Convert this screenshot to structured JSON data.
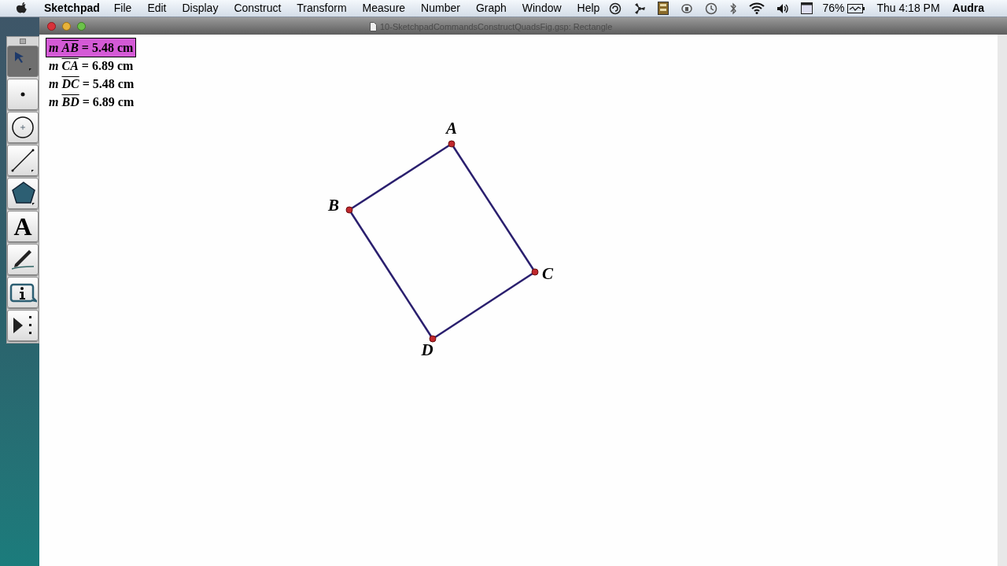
{
  "menu_bar": {
    "app": "Sketchpad",
    "menus": [
      "File",
      "Edit",
      "Display",
      "Construct",
      "Transform",
      "Measure",
      "Number",
      "Graph",
      "Window",
      "Help"
    ],
    "battery": "76%",
    "clock": "Thu 4:18 PM",
    "user": "Audra"
  },
  "window": {
    "title": "10-SketchpadCommandsConstructQuadsFig.gsp: Rectangle"
  },
  "toolbox": [
    {
      "kind": "arrow",
      "selected": true
    },
    {
      "kind": "point",
      "selected": false
    },
    {
      "kind": "compass",
      "selected": false
    },
    {
      "kind": "straightedge",
      "selected": false
    },
    {
      "kind": "polygon",
      "selected": false
    },
    {
      "kind": "text",
      "selected": false,
      "glyph": "A"
    },
    {
      "kind": "marker",
      "selected": false
    },
    {
      "kind": "information",
      "selected": false
    },
    {
      "kind": "custom",
      "selected": false
    }
  ],
  "measurements": [
    {
      "prefix": "m",
      "segment": "AB",
      "result": "= 5.48 cm",
      "selected": true
    },
    {
      "prefix": "m",
      "segment": "CA",
      "result": "= 6.89 cm",
      "selected": false
    },
    {
      "prefix": "m",
      "segment": "DC",
      "result": "= 5.48 cm",
      "selected": false
    },
    {
      "prefix": "m",
      "segment": "BD",
      "result": "= 6.89 cm",
      "selected": false
    }
  ],
  "points": [
    {
      "label": "A"
    },
    {
      "label": "B"
    },
    {
      "label": "C"
    },
    {
      "label": "D"
    }
  ]
}
